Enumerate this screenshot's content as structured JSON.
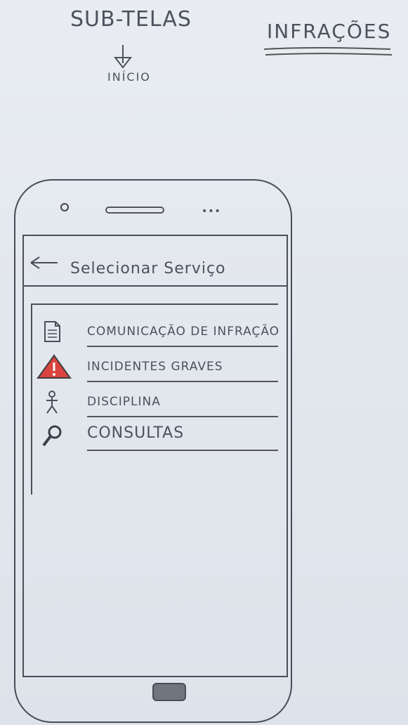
{
  "annotations": {
    "top_left_title": "SUB-TELAS",
    "arrow_label": "INÍCIO",
    "top_right_title": "INFRAÇÕES"
  },
  "device": {
    "sensors_text": "•••"
  },
  "topbar": {
    "title": "Selecionar Serviço"
  },
  "menu": {
    "items": [
      {
        "label": "COMUNICAÇÃO DE INFRAÇÃO",
        "icon": "document-icon"
      },
      {
        "label": "INCIDENTES GRAVES",
        "icon": "warning-icon"
      },
      {
        "label": "DISCIPLINA",
        "icon": "person-icon"
      },
      {
        "label": "CONSULTAS",
        "icon": "search-icon"
      }
    ]
  },
  "colors": {
    "warning_red": "#d9443f"
  }
}
